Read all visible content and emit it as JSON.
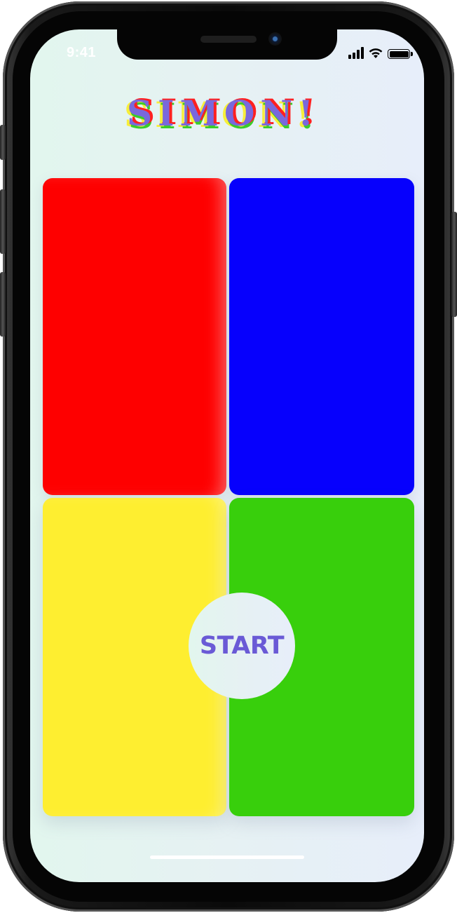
{
  "status_bar": {
    "time": "9:41",
    "signal_icon": "cellular-signal-icon",
    "wifi_icon": "wifi-icon",
    "battery_icon": "battery-icon"
  },
  "game": {
    "title": "SIMON!",
    "start_label": "START",
    "quadrants": [
      {
        "id": "red",
        "color": "#fe0000"
      },
      {
        "id": "blue",
        "color": "#0600fd"
      },
      {
        "id": "yellow",
        "color": "#feee30"
      },
      {
        "id": "green",
        "color": "#38cf0c"
      }
    ]
  },
  "colors": {
    "title_main": "#7a68dc",
    "start_text": "#6a5ad6",
    "background_start": "#e2f6ee",
    "background_end": "#e7eefa"
  }
}
